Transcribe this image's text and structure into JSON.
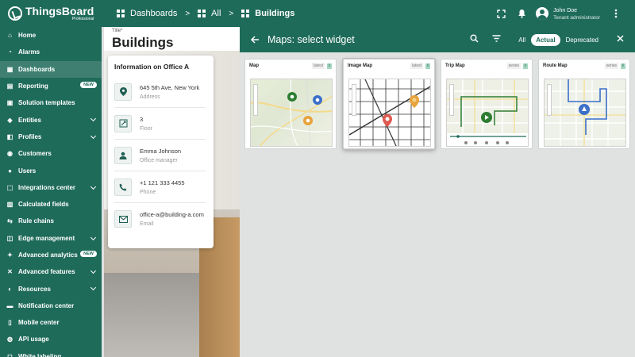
{
  "brand": {
    "name": "ThingsBoard",
    "edition": "Professional"
  },
  "breadcrumbs": [
    {
      "label": "Dashboards"
    },
    {
      "label": "All"
    },
    {
      "label": "Buildings"
    }
  ],
  "user": {
    "name": "John Doe",
    "role": "Tenant administrator"
  },
  "sidebar": {
    "items": [
      {
        "label": "Home",
        "icon": "home-icon"
      },
      {
        "label": "Alarms",
        "icon": "alarm-icon"
      },
      {
        "label": "Dashboards",
        "icon": "dashboard-icon",
        "active": true
      },
      {
        "label": "Reporting",
        "icon": "report-icon",
        "badge": "NEW"
      },
      {
        "label": "Solution templates",
        "icon": "template-icon"
      },
      {
        "label": "Entities",
        "icon": "entities-icon",
        "expandable": true
      },
      {
        "label": "Profiles",
        "icon": "profiles-icon",
        "expandable": true
      },
      {
        "label": "Customers",
        "icon": "customers-icon"
      },
      {
        "label": "Users",
        "icon": "users-icon"
      },
      {
        "label": "Integrations center",
        "icon": "integrations-icon",
        "expandable": true
      },
      {
        "label": "Calculated fields",
        "icon": "calculated-icon"
      },
      {
        "label": "Rule chains",
        "icon": "rule-chain-icon"
      },
      {
        "label": "Edge management",
        "icon": "edge-icon",
        "expandable": true
      },
      {
        "label": "Advanced analytics",
        "icon": "analytics-icon",
        "badge": "NEW"
      },
      {
        "label": "Advanced features",
        "icon": "features-icon",
        "expandable": true
      },
      {
        "label": "Resources",
        "icon": "resources-icon",
        "expandable": true
      },
      {
        "label": "Notification center",
        "icon": "notification-icon"
      },
      {
        "label": "Mobile center",
        "icon": "mobile-icon"
      },
      {
        "label": "API usage",
        "icon": "api-icon"
      },
      {
        "label": "White labeling",
        "icon": "white-label-icon"
      }
    ]
  },
  "dashboard": {
    "title_label": "Title*",
    "title": "Buildings",
    "info_card": {
      "heading": "Information on Office A",
      "rows": [
        {
          "value": "645 5th Ave, New York",
          "label": "Address",
          "icon": "location-icon"
        },
        {
          "value": "3",
          "label": "Floor",
          "icon": "floor-icon"
        },
        {
          "value": "Emma Johnson",
          "label": "Office manager",
          "icon": "person-icon"
        },
        {
          "value": "+1 121 333 4455",
          "label": "Phone",
          "icon": "phone-icon"
        },
        {
          "value": "office-a@building-a.com",
          "label": "Email",
          "icon": "email-icon"
        }
      ]
    }
  },
  "widget_panel": {
    "title": "Maps: select widget",
    "filters": [
      {
        "label": "All"
      },
      {
        "label": "Actual",
        "selected": true
      },
      {
        "label": "Deprecated"
      }
    ],
    "widgets": [
      {
        "title": "Map",
        "tag": "latest"
      },
      {
        "title": "Image Map",
        "tag": "latest",
        "highlighted": true
      },
      {
        "title": "Trip Map",
        "tag": "series"
      },
      {
        "title": "Route Map",
        "tag": "series"
      }
    ]
  },
  "colors": {
    "primary": "#1f6b5a",
    "panel_bg": "#dfe2e0",
    "accent_green": "#2e7d32",
    "accent_orange": "#e8a33c",
    "accent_red": "#e05a4f",
    "accent_blue": "#3b6fc9"
  }
}
